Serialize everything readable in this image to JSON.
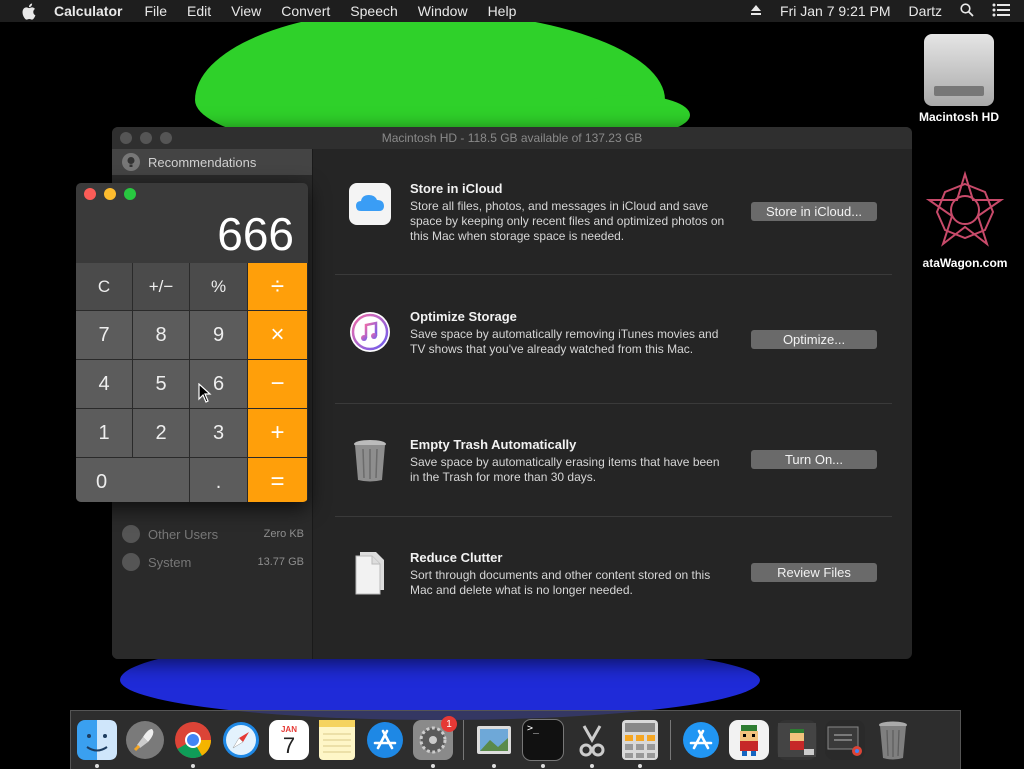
{
  "menubar": {
    "app": "Calculator",
    "menus": [
      "File",
      "Edit",
      "View",
      "Convert",
      "Speech",
      "Window",
      "Help"
    ],
    "datetime": "Fri Jan 7  9:21 PM",
    "user": "Dartz"
  },
  "desktop": {
    "hd_label": "Macintosh HD",
    "datawagon_label": "ataWagon.com"
  },
  "storage": {
    "title": "Macintosh HD - 118.5 GB available of 137.23 GB",
    "sidebar": {
      "selected": "Recommendations",
      "rows": [
        {
          "label": "Other Users",
          "size": "Zero KB"
        },
        {
          "label": "System",
          "size": "13.77 GB"
        }
      ]
    },
    "recommendations": [
      {
        "title": "Store in iCloud",
        "desc": "Store all files, photos, and messages in iCloud and save space by keeping only recent files and optimized photos on this Mac when storage space is needed.",
        "button": "Store in iCloud..."
      },
      {
        "title": "Optimize Storage",
        "desc": "Save space by automatically removing iTunes movies and TV shows that you've already watched from this Mac.",
        "button": "Optimize..."
      },
      {
        "title": "Empty Trash Automatically",
        "desc": "Save space by automatically erasing items that have been in the Trash for more than 30 days.",
        "button": "Turn On..."
      },
      {
        "title": "Reduce Clutter",
        "desc": "Sort through documents and other content stored on this Mac and delete what is no longer needed.",
        "button": "Review Files"
      }
    ]
  },
  "calculator": {
    "display": "666",
    "keys": {
      "clear": "C",
      "sign": "+/−",
      "percent": "%",
      "divide": "÷",
      "seven": "7",
      "eight": "8",
      "nine": "9",
      "multiply": "×",
      "four": "4",
      "five": "5",
      "six": "6",
      "minus": "−",
      "one": "1",
      "two": "2",
      "three": "3",
      "plus": "+",
      "zero": "0",
      "decimal": ".",
      "equals": "="
    }
  },
  "dock": {
    "calendar_month": "JAN",
    "calendar_day": "7",
    "settings_badge": "1",
    "terminal_prompt": ">_"
  }
}
